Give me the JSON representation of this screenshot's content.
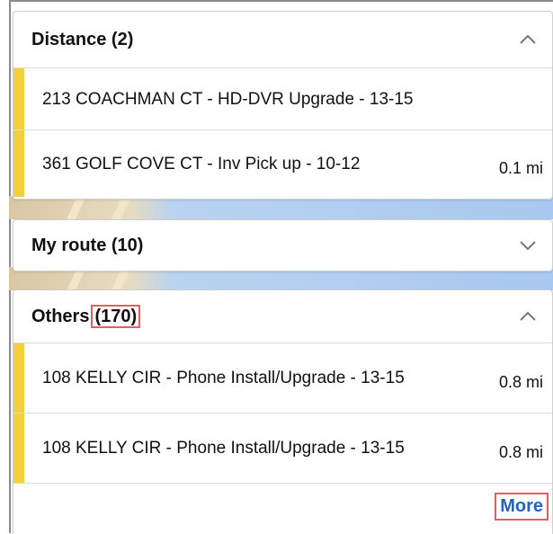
{
  "sections": {
    "distance": {
      "title": "Distance (2)",
      "items": [
        {
          "title": "213 COACHMAN CT - HD-DVR Upgrade - 13-15",
          "distance": ""
        },
        {
          "title": "361 GOLF COVE CT - Inv Pick up - 10-12",
          "distance": "0.1 mi"
        }
      ]
    },
    "my_route": {
      "title": "My route (10)"
    },
    "others": {
      "title": "Others",
      "count": "(170)",
      "items": [
        {
          "title": "108 KELLY CIR - Phone Install/Upgrade - 13-15",
          "distance": "0.8 mi"
        },
        {
          "title": "108 KELLY CIR - Phone Install/Upgrade - 13-15",
          "distance": "0.8 mi"
        }
      ],
      "more_label": "More"
    }
  },
  "colors": {
    "accent_bar": "#f3cf3e",
    "link": "#1f63c9",
    "highlight_box": "#e06060"
  },
  "icons": {
    "expanded": "chevron-up-icon",
    "collapsed": "chevron-down-icon"
  }
}
